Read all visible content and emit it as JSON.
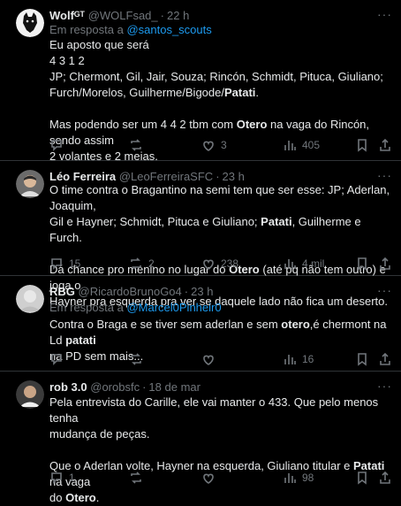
{
  "tweets": [
    {
      "name": "Wolfᴳᵀ",
      "handle": "@WOLFsad_",
      "time": "22 h",
      "reply_prefix": "Em resposta a",
      "reply_to": "@santos_scouts",
      "lines": [
        "Eu aposto que será",
        "4 3 1 2",
        "JP; Chermont, Gil, Jair, Souza; Rincón, Schmidt, Pituca, Giuliano;",
        "Furch/Morelos, Guilherme/Bigode/",
        "Patati",
        ".",
        "Mas podendo ser um 4 4 2 tbm com ",
        "Otero",
        " na vaga do Rincón, sendo assim",
        "2 volantes e 2 meias."
      ],
      "replies": "",
      "reposts": "",
      "likes": "3",
      "views": "405"
    },
    {
      "name": "Léo Ferreira",
      "handle": "@LeoFerreiraSFC",
      "time": "23 h",
      "lines": [
        "O time contra o Bragantino na semi tem que ser esse: JP; Aderlan, Joaquim,",
        "Gil e Hayner; Schmidt, Pituca e Giuliano; ",
        "Patati",
        ", Guilherme e Furch.",
        "Dá chance pro menino no lugar do ",
        "Otero",
        " (até pq não tem outro) e joga o",
        "Hayner pra esquerda pra ver se daquele lado não fica um deserto."
      ],
      "replies": "15",
      "reposts": "2",
      "likes": "238",
      "views": "4 mil"
    },
    {
      "name": "RBG",
      "handle": "@RicardoBrunoGo4",
      "time": "23 h",
      "reply_prefix": "Em resposta a",
      "reply_to": "@Marcel0Pinheir0",
      "lines": [
        "Contra o Braga e se tiver sem aderlan e sem ",
        "otero",
        ",é chermont na Ld ",
        "patati",
        "na PD sem mais..."
      ],
      "replies": "",
      "reposts": "",
      "likes": "",
      "views": "16"
    },
    {
      "name": "rob 3.0",
      "handle": "@orobsfc",
      "time": "18 de mar",
      "lines": [
        "Pela entrevista do Carille, ele vai manter o 433. Que pelo menos tenha",
        "mudança de peças.",
        "Que o Aderlan volte, Hayner na esquerda, Giuliano titular e ",
        "Patati",
        " na vaga",
        "do ",
        "Otero",
        "."
      ],
      "replies": "1",
      "reposts": "",
      "likes": "",
      "views": "98"
    }
  ],
  "colors": {
    "bg": "#000000",
    "text": "#e7e9ea",
    "muted": "#71767b",
    "link": "#1d9bf0",
    "divider": "#2f3336"
  },
  "icons": [
    "reply-icon",
    "repost-icon",
    "like-icon",
    "views-icon",
    "bookmark-icon",
    "share-icon",
    "more-icon"
  ]
}
